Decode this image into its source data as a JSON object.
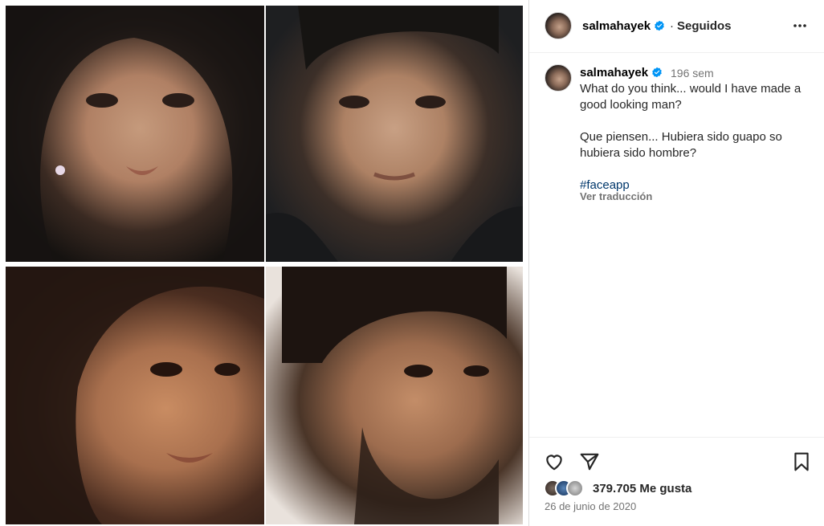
{
  "post": {
    "username": "salmahayek",
    "follow_state": "Seguidos",
    "separator": "·",
    "caption": {
      "time_ago": "196 sem",
      "lines_en": "What do you think... would I have made a good looking man?",
      "lines_es": "Que piensen... Hubiera sido guapo so hubiera sido hombre?",
      "hashtag": "#faceapp",
      "translate_label": "Ver traducción"
    },
    "likes": "379.705 Me gusta",
    "date": "26 de junio de 2020"
  },
  "icons": {
    "verified": "verified-badge-icon",
    "more": "more-options-icon",
    "like": "heart-icon",
    "share": "paper-plane-icon",
    "save": "bookmark-icon"
  },
  "colors": {
    "verified": "#0095f6",
    "hashtag": "#00376b",
    "muted": "#737373",
    "text": "#262626"
  }
}
